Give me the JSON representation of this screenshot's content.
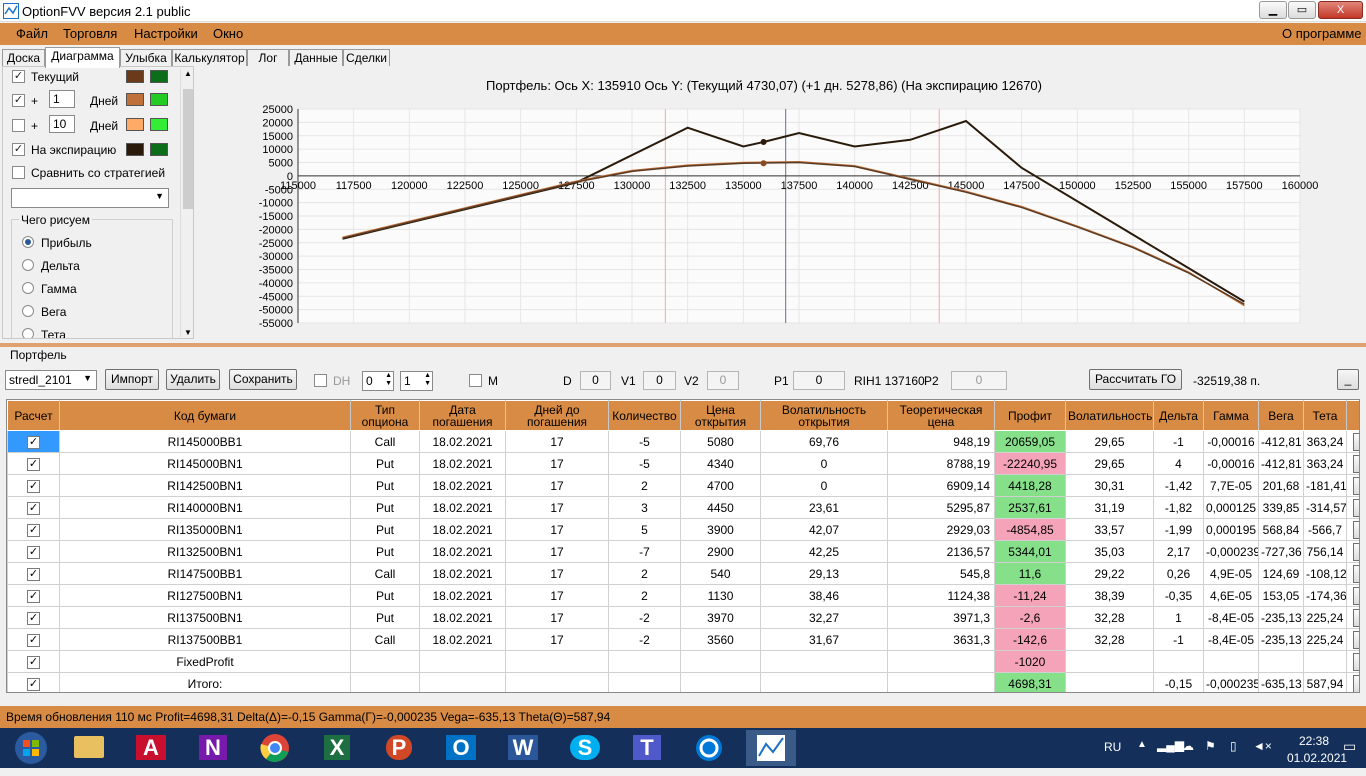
{
  "window": {
    "title": "OptionFVV версия 2.1 public",
    "min": "▁",
    "max": "▭",
    "close": "X"
  },
  "menu": {
    "file": "Файл",
    "trade": "Торговля",
    "settings": "Настройки",
    "window": "Окно",
    "about": "О программе"
  },
  "tabs": [
    "Доска",
    "Диаграмма",
    "Улыбка",
    "Калькулятор",
    "Лог",
    "Данные",
    "Сделки"
  ],
  "left_panel": {
    "current_label": "Текущий",
    "plus": "+",
    "days_label": "Дней",
    "days1": "1",
    "days2": "10",
    "expiration_label": "На экспирацию",
    "compare_label": "Сравнить со стратегией",
    "group_title": "Чего рисуем",
    "radios": [
      "Прибыль",
      "Дельта",
      "Гамма",
      "Вега",
      "Тета"
    ]
  },
  "chart_header": "Портфель: Ось X: 135910 Ось Y:  (Текущий 4730,07)  (+1 дн. 5278,86)  (На экспирацию 12670)",
  "chart_data": {
    "type": "line",
    "xlim": [
      115000,
      160000
    ],
    "ylim": [
      -55000,
      25000
    ],
    "x_ticks": [
      "115000",
      "117500",
      "120000",
      "122500",
      "125000",
      "127500",
      "130000",
      "132500",
      "135000",
      "137500",
      "140000",
      "142500",
      "145000",
      "147500",
      "150000",
      "152500",
      "155000",
      "157500",
      "160000"
    ],
    "y_ticks": [
      "25000",
      "20000",
      "15000",
      "10000",
      "5000",
      "0",
      "-5000",
      "-10000",
      "-15000",
      "-20000",
      "-25000",
      "-30000",
      "-35000",
      "-40000",
      "-45000",
      "-50000",
      "-55000"
    ],
    "series": [
      {
        "color": "#2a1a0a",
        "x": [
          117000,
          127500,
          132500,
          135000,
          135910,
          137500,
          140000,
          142500,
          145000,
          147500,
          157500
        ],
        "y": [
          -23500,
          -2500,
          18000,
          11000,
          12670,
          16000,
          11000,
          13500,
          20500,
          3000,
          -47000
        ]
      },
      {
        "color": "#c0703a",
        "x": [
          117000,
          122500,
          127500,
          130000,
          132500,
          135000,
          137500,
          140000,
          142500,
          145000,
          147500,
          150000,
          152500,
          155000,
          157500
        ],
        "y": [
          -23000,
          -12000,
          -2000,
          2000,
          4000,
          5000,
          5300,
          3800,
          -1000,
          -5800,
          -11500,
          -18800,
          -26500,
          -36000,
          -48500
        ]
      },
      {
        "color": "#5a3a22",
        "x": [
          117000,
          122500,
          127500,
          130000,
          132500,
          135000,
          137500,
          140000,
          142500,
          145000,
          147500,
          150000,
          152500,
          155000,
          157500
        ],
        "y": [
          -23300,
          -12300,
          -2300,
          1700,
          3700,
          4730,
          5000,
          3500,
          -1300,
          -6100,
          -11800,
          -19100,
          -26800,
          -36300,
          -48000
        ]
      }
    ],
    "markers": [
      {
        "x": 135910,
        "y": 12670
      },
      {
        "x": 135910,
        "y": 4730
      }
    ],
    "vlines": [
      {
        "x": 131500,
        "color": "#ffb0b0"
      },
      {
        "x": 136900,
        "color": "#7a8a9a"
      },
      {
        "x": 143800,
        "color": "#ffb0b0"
      }
    ]
  },
  "portfolio": {
    "label": "Портфель",
    "strategy": "stredl_2101",
    "import": "Импорт",
    "delete": "Удалить",
    "save": "Сохранить",
    "dh": "DH",
    "spin1": "0",
    "spin2": "1",
    "m": "M",
    "d_label": "D",
    "d_val": "0",
    "v1_label": "V1",
    "v1_val": "0",
    "v2_label": "V2",
    "v2_val": "0",
    "p1_label": "P1",
    "p1_val": "0",
    "rih": "RIH1 137160",
    "p2_label": "P2",
    "p2_val": "0",
    "calc_go": "Рассчитать ГО",
    "go_value": "-32519,38 п.",
    "min_btn": "_"
  },
  "table": {
    "headers": [
      "Расчет",
      "Код бумаги",
      "Тип опциона",
      "Дата погашения",
      "Дней до погашения",
      "Количество",
      "Цена открытия",
      "Волатильность открытия",
      "Теоретическая цена",
      "Профит",
      "Волатильность",
      "Дельта",
      "Гамма",
      "Вега",
      "Тета",
      "X"
    ],
    "rows": [
      [
        "RI145000BB1",
        "Call",
        "18.02.2021",
        "17",
        "-5",
        "5080",
        "69,76",
        "948,19",
        "20659,05",
        "29,65",
        "-1",
        "-0,00016",
        "-412,81",
        "363,24"
      ],
      [
        "RI145000BN1",
        "Put",
        "18.02.2021",
        "17",
        "-5",
        "4340",
        "0",
        "8788,19",
        "-22240,95",
        "29,65",
        "4",
        "-0,00016",
        "-412,81",
        "363,24"
      ],
      [
        "RI142500BN1",
        "Put",
        "18.02.2021",
        "17",
        "2",
        "4700",
        "0",
        "6909,14",
        "4418,28",
        "30,31",
        "-1,42",
        "7,7E-05",
        "201,68",
        "-181,41"
      ],
      [
        "RI140000BN1",
        "Put",
        "18.02.2021",
        "17",
        "3",
        "4450",
        "23,61",
        "5295,87",
        "2537,61",
        "31,19",
        "-1,82",
        "0,000125",
        "339,85",
        "-314,57"
      ],
      [
        "RI135000BN1",
        "Put",
        "18.02.2021",
        "17",
        "5",
        "3900",
        "42,07",
        "2929,03",
        "-4854,85",
        "33,57",
        "-1,99",
        "0,000195",
        "568,84",
        "-566,7"
      ],
      [
        "RI132500BN1",
        "Put",
        "18.02.2021",
        "17",
        "-7",
        "2900",
        "42,25",
        "2136,57",
        "5344,01",
        "35,03",
        "2,17",
        "-0,000239",
        "-727,36",
        "756,14"
      ],
      [
        "RI147500BB1",
        "Call",
        "18.02.2021",
        "17",
        "2",
        "540",
        "29,13",
        "545,8",
        "11,6",
        "29,22",
        "0,26",
        "4,9E-05",
        "124,69",
        "-108,12"
      ],
      [
        "RI127500BN1",
        "Put",
        "18.02.2021",
        "17",
        "2",
        "1130",
        "38,46",
        "1124,38",
        "-11,24",
        "38,39",
        "-0,35",
        "4,6E-05",
        "153,05",
        "-174,36"
      ],
      [
        "RI137500BN1",
        "Put",
        "18.02.2021",
        "17",
        "-2",
        "3970",
        "32,27",
        "3971,3",
        "-2,6",
        "32,28",
        "1",
        "-8,4E-05",
        "-235,13",
        "225,24"
      ],
      [
        "RI137500BB1",
        "Call",
        "18.02.2021",
        "17",
        "-2",
        "3560",
        "31,67",
        "3631,3",
        "-142,6",
        "32,28",
        "-1",
        "-8,4E-05",
        "-235,13",
        "225,24"
      ]
    ],
    "fixed_label": "FixedProfit",
    "fixed_value": "-1020",
    "total_label": "Итого:",
    "total_profit": "4698,31",
    "total_delta": "-0,15",
    "total_gamma": "-0,000235",
    "total_vega": "-635,13",
    "total_theta": "587,94",
    "check": "✓",
    "x": "X"
  },
  "status": "Время обновления 110 мс  Profit=4698,31 Delta(Δ)=-0,15 Gamma(Γ)=-0,000235 Vega=-635,13 Theta(Θ)=587,94",
  "taskbar": {
    "apps": [
      "win-start",
      "explorer",
      "pdf",
      "onenote",
      "chrome",
      "excel",
      "powerpoint",
      "outlook",
      "word",
      "skype",
      "teams",
      "cortana",
      "optionfvv"
    ],
    "app_letters": {
      "pdf": "A",
      "onenote": "N",
      "excel": "X",
      "powerpoint": "P",
      "outlook": "O",
      "word": "W",
      "skype": "S",
      "teams": "T"
    },
    "lang": "RU",
    "time": "22:38",
    "date": "01.02.2021"
  },
  "colors": {
    "orange": "#d88b45",
    "profit_pos": "#86e08a",
    "profit_neg": "#f5a3b8",
    "selection": "#3399ff"
  }
}
